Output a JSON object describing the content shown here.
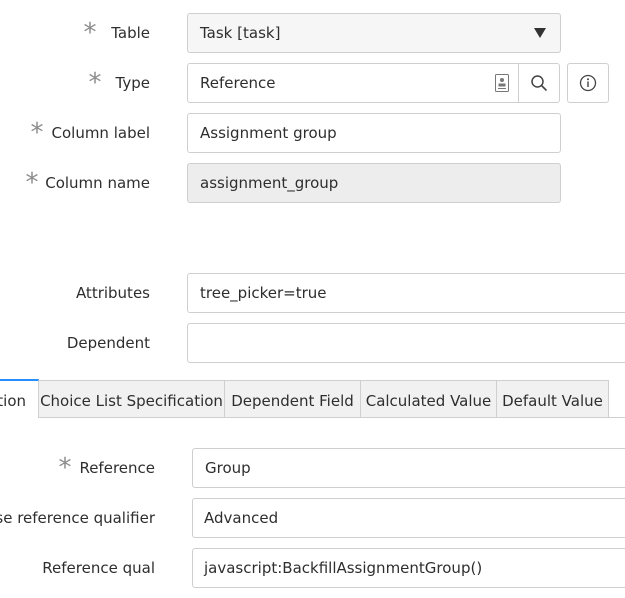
{
  "form": {
    "table": {
      "label": "Table",
      "value": "Task [task]"
    },
    "type": {
      "label": "Type",
      "value": "Reference"
    },
    "column_label": {
      "label": "Column label",
      "value": "Assignment group"
    },
    "column_name": {
      "label": "Column name",
      "value": "assignment_group"
    },
    "attributes": {
      "label": "Attributes",
      "value": "tree_picker=true"
    },
    "dependent": {
      "label": "Dependent",
      "value": ""
    }
  },
  "tabs": [
    {
      "label": "tion",
      "active": true
    },
    {
      "label": "Choice List Specification",
      "active": false
    },
    {
      "label": "Dependent Field",
      "active": false
    },
    {
      "label": "Calculated Value",
      "active": false
    },
    {
      "label": "Default Value",
      "active": false
    }
  ],
  "reference_section": {
    "reference": {
      "label": "Reference",
      "value": "Group"
    },
    "use_reference_qualifier": {
      "label": "Use reference qualifier",
      "value": "Advanced"
    },
    "reference_qual": {
      "label": "Reference qual",
      "value": "javascript:BackfillAssignmentGroup()"
    }
  },
  "icons": {
    "required": "asterisk-icon",
    "dropdown": "chevron-down-icon",
    "document": "document-icon",
    "lookup": "search-icon",
    "info": "info-icon"
  },
  "colors": {
    "active_tab_accent": "#278efc",
    "border": "#cfcfcf",
    "readonly_bg": "#ededed"
  }
}
